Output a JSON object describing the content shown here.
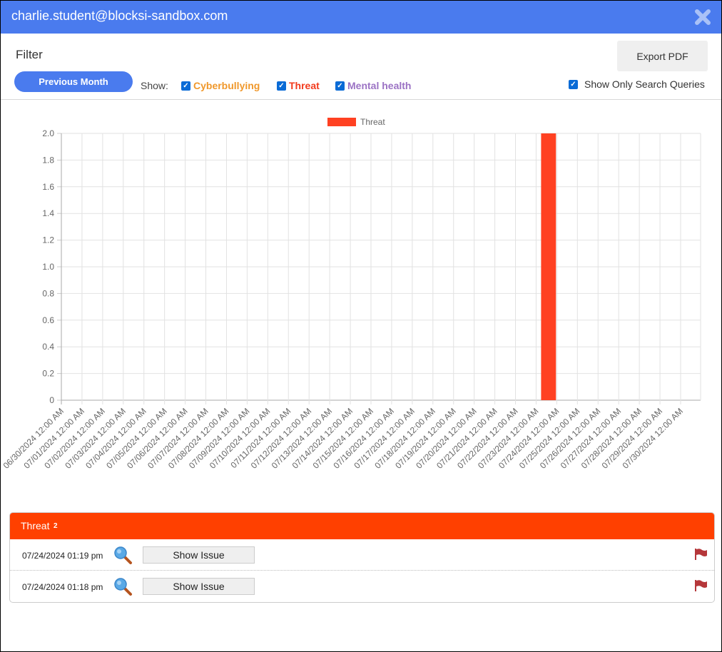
{
  "dialog": {
    "title": "charlie.student@blocksi-sandbox.com",
    "close_icon": "close-x-icon"
  },
  "filter": {
    "label": "Filter",
    "export_label": "Export PDF",
    "period_label": "Previous Month",
    "show_label": "Show:",
    "categories": [
      {
        "label": "Cyberbullying",
        "checked": true,
        "color": "#f0982b"
      },
      {
        "label": "Threat",
        "checked": true,
        "color": "#ff4000"
      },
      {
        "label": "Mental health",
        "checked": true,
        "color": "#9b72c4"
      }
    ],
    "search_only": {
      "label": "Show Only Search Queries",
      "checked": true
    }
  },
  "colors": {
    "titlebar": "#4a7bee",
    "threat_bar": "#ff4122",
    "threat_header": "#ff4000",
    "flag": "#b5373a"
  },
  "chart_data": {
    "type": "bar",
    "title": "",
    "xlabel": "",
    "ylabel": "",
    "ylim": [
      0,
      2.0
    ],
    "yticks": [
      "0",
      "0.2",
      "0.4",
      "0.6",
      "0.8",
      "1.0",
      "1.2",
      "1.4",
      "1.6",
      "1.8",
      "2.0"
    ],
    "grid": true,
    "legend_position": "top",
    "categories": [
      "06/30/2024 12:00 AM",
      "07/01/2024 12:00 AM",
      "07/02/2024 12:00 AM",
      "07/03/2024 12:00 AM",
      "07/04/2024 12:00 AM",
      "07/05/2024 12:00 AM",
      "07/06/2024 12:00 AM",
      "07/07/2024 12:00 AM",
      "07/08/2024 12:00 AM",
      "07/09/2024 12:00 AM",
      "07/10/2024 12:00 AM",
      "07/11/2024 12:00 AM",
      "07/12/2024 12:00 AM",
      "07/13/2024 12:00 AM",
      "07/14/2024 12:00 AM",
      "07/15/2024 12:00 AM",
      "07/16/2024 12:00 AM",
      "07/17/2024 12:00 AM",
      "07/18/2024 12:00 AM",
      "07/19/2024 12:00 AM",
      "07/20/2024 12:00 AM",
      "07/21/2024 12:00 AM",
      "07/22/2024 12:00 AM",
      "07/23/2024 12:00 AM",
      "07/24/2024 12:00 AM",
      "07/25/2024 12:00 AM",
      "07/26/2024 12:00 AM",
      "07/27/2024 12:00 AM",
      "07/28/2024 12:00 AM",
      "07/29/2024 12:00 AM",
      "07/30/2024 12:00 AM"
    ],
    "series": [
      {
        "name": "Threat",
        "color": "#ff4122",
        "points": [
          {
            "x": "07/24/2024",
            "value": 2
          }
        ]
      }
    ]
  },
  "threat_panel": {
    "title": "Threat",
    "count": "2",
    "rows": [
      {
        "timestamp": "07/24/2024 01:19 pm",
        "button": "Show Issue"
      },
      {
        "timestamp": "07/24/2024 01:18 pm",
        "button": "Show Issue"
      }
    ]
  }
}
